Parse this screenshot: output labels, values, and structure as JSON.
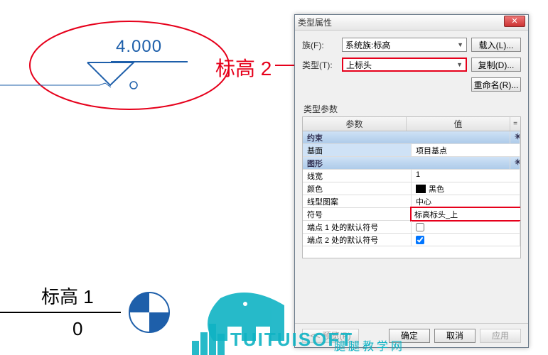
{
  "annotation": {
    "label": "标高 2"
  },
  "datum": {
    "value": "4.000"
  },
  "level1": {
    "label": "标高 1",
    "value": "0"
  },
  "dialog": {
    "title": "类型属性",
    "family_lbl": "族(F):",
    "family_value": "系统族:标高",
    "type_lbl": "类型(T):",
    "type_value": "上标头",
    "load_btn": "载入(L)...",
    "copy_btn": "复制(D)...",
    "rename_btn": "重命名(R)...",
    "params_label": "类型参数",
    "col_param": "参数",
    "col_value": "值",
    "section_constraints": "约束",
    "row_base_param": "基面",
    "row_base_value": "项目基点",
    "section_graphics": "图形",
    "row_lw_param": "线宽",
    "row_lw_value": "1",
    "row_color_param": "颜色",
    "row_color_value": "黑色",
    "row_pattern_param": "线型图案",
    "row_pattern_value": "中心",
    "row_symbol_param": "符号",
    "row_symbol_value": "标高标头_上",
    "row_end1_param": "端点 1 处的默认符号",
    "row_end2_param": "端点 2 处的默认符号",
    "footer_preview": "<< 预览(P)",
    "footer_ok": "确定",
    "footer_cancel": "取消",
    "footer_apply": "应用"
  },
  "watermark": {
    "brand": "TUITUISOFT",
    "sub": "腿腿教学网"
  }
}
